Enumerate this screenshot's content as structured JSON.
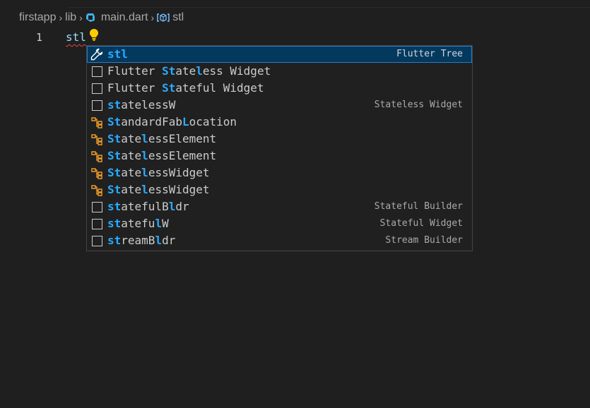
{
  "breadcrumb": {
    "items": [
      {
        "label": "firstapp"
      },
      {
        "label": "lib"
      },
      {
        "label": "main.dart"
      },
      {
        "label": "stl"
      }
    ]
  },
  "editor": {
    "line_number": "1",
    "typed_text": "stl"
  },
  "suggestions": {
    "items": [
      {
        "icon": "wrench-icon",
        "pre": "",
        "match": "stl",
        "post": "",
        "detail": "Flutter Tree",
        "selected": true
      },
      {
        "icon": "snippet-icon",
        "segments": [
          [
            "Flutter ",
            false
          ],
          [
            "St",
            true
          ],
          [
            "ate",
            false
          ],
          [
            "l",
            true
          ],
          [
            "ess Widget",
            false
          ]
        ],
        "detail": ""
      },
      {
        "icon": "snippet-icon",
        "segments": [
          [
            "Flutter ",
            false
          ],
          [
            "St",
            true
          ],
          [
            "ateful ",
            false
          ],
          [
            "W",
            false
          ],
          [
            "idget",
            false
          ]
        ],
        "detail": ""
      },
      {
        "icon": "snippet-icon",
        "segments": [
          [
            "st",
            true
          ],
          [
            "atelessW",
            false
          ]
        ],
        "detail": "Stateless Widget"
      },
      {
        "icon": "class-icon",
        "segments": [
          [
            "St",
            true
          ],
          [
            "andardFab",
            false
          ],
          [
            "L",
            true
          ],
          [
            "ocation",
            false
          ]
        ],
        "detail": ""
      },
      {
        "icon": "class-icon",
        "segments": [
          [
            "St",
            true
          ],
          [
            "ate",
            false
          ],
          [
            "l",
            true
          ],
          [
            "essElement",
            false
          ]
        ],
        "detail": ""
      },
      {
        "icon": "class-icon",
        "segments": [
          [
            "St",
            true
          ],
          [
            "ate",
            false
          ],
          [
            "l",
            true
          ],
          [
            "essElement",
            false
          ]
        ],
        "detail": ""
      },
      {
        "icon": "class-icon",
        "segments": [
          [
            "St",
            true
          ],
          [
            "ate",
            false
          ],
          [
            "l",
            true
          ],
          [
            "essWidget",
            false
          ]
        ],
        "detail": ""
      },
      {
        "icon": "class-icon",
        "segments": [
          [
            "St",
            true
          ],
          [
            "ate",
            false
          ],
          [
            "l",
            true
          ],
          [
            "essWidget",
            false
          ]
        ],
        "detail": ""
      },
      {
        "icon": "snippet-icon",
        "segments": [
          [
            "st",
            true
          ],
          [
            "ateful",
            false
          ],
          [
            "B",
            false
          ],
          [
            "l",
            true
          ],
          [
            "dr",
            false
          ]
        ],
        "detail": "Stateful Builder"
      },
      {
        "icon": "snippet-icon",
        "segments": [
          [
            "st",
            true
          ],
          [
            "atefu",
            false
          ],
          [
            "l",
            true
          ],
          [
            "W",
            false
          ]
        ],
        "detail": "Stateful Widget"
      },
      {
        "icon": "snippet-icon",
        "segments": [
          [
            "st",
            true
          ],
          [
            "reamB",
            false
          ],
          [
            "l",
            true
          ],
          [
            "dr",
            false
          ]
        ],
        "detail": "Stream Builder"
      }
    ]
  },
  "colors": {
    "background": "#1f1f1f",
    "selection": "#04395e",
    "match_highlight": "#2aaaff",
    "class_icon": "#ee9d28",
    "bulb": "#ffcc00"
  }
}
